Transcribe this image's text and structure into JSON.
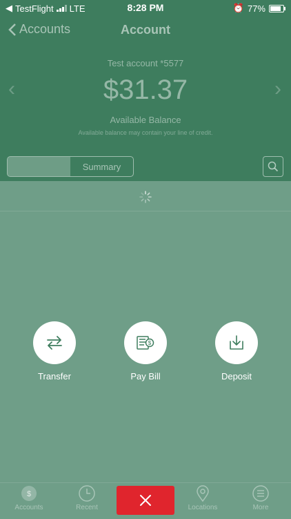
{
  "status_bar": {
    "carrier": "TestFlight",
    "network": "LTE",
    "time": "8:28 PM",
    "battery": "77%"
  },
  "nav": {
    "back_label": "Accounts",
    "title": "Account"
  },
  "account": {
    "name": "Test account *5577",
    "balance": "$31.37",
    "balance_label": "Available Balance",
    "note": "Available balance may contain your line of credit."
  },
  "segment": {
    "option2": "Summary"
  },
  "actions": [
    {
      "label": "Transfer",
      "icon": "transfer-icon"
    },
    {
      "label": "Pay Bill",
      "icon": "pay-bill-icon"
    },
    {
      "label": "Deposit",
      "icon": "deposit-icon"
    }
  ],
  "tabs": [
    {
      "label": "Accounts",
      "icon": "accounts-icon"
    },
    {
      "label": "Recent",
      "icon": "clock-icon"
    },
    {
      "label": "Locations",
      "icon": "location-pin-icon"
    },
    {
      "label": "More",
      "icon": "menu-icon"
    }
  ],
  "colors": {
    "header_green": "#3e7d5e",
    "overlay_green": "#6f9e88",
    "close_red": "#e0252d"
  }
}
